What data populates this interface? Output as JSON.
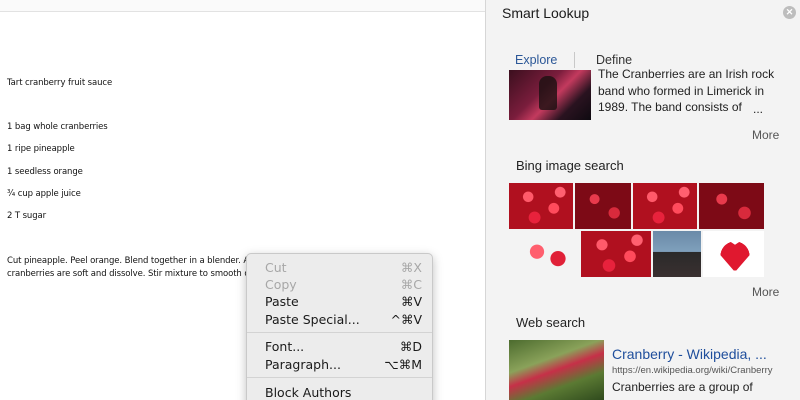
{
  "document": {
    "lines": [
      "Tart cranberry fruit sauce",
      "1 bag whole cranberries",
      "1 ripe pineapple",
      "1 seedless orange",
      "¾ cup apple juice",
      "2 T sugar",
      "Cut pineapple. Peel orange. Blend together in a blender. Add cran",
      "cranberries are soft and dissolve. Stir mixture to smooth out cran"
    ]
  },
  "context_menu": {
    "items": [
      {
        "label": "Cut",
        "shortcut": "⌘X",
        "enabled": false
      },
      {
        "label": "Copy",
        "shortcut": "⌘C",
        "enabled": false
      },
      {
        "label": "Paste",
        "shortcut": "⌘V",
        "enabled": true
      },
      {
        "label": "Paste Special...",
        "shortcut": "^⌘V",
        "enabled": true
      },
      {
        "label": "Font...",
        "shortcut": "⌘D",
        "enabled": true
      },
      {
        "label": "Paragraph...",
        "shortcut": "⌥⌘M",
        "enabled": true
      },
      {
        "label": "Block Authors",
        "shortcut": "",
        "enabled": true
      }
    ]
  },
  "smart_lookup": {
    "title": "Smart Lookup",
    "close_icon": "close-icon",
    "tabs": [
      {
        "label": "Explore",
        "active": true
      },
      {
        "label": "Define",
        "active": false
      }
    ],
    "explore": {
      "snippet_lines": [
        "The Cranberries are an Irish rock",
        "band who formed in Limerick in",
        "1989. The band consists of",
        "..."
      ],
      "more": "More"
    },
    "bing": {
      "heading": "Bing image search",
      "more": "More"
    },
    "web": {
      "heading": "Web search",
      "link": "Cranberry - Wikipedia, ...",
      "url": "https://en.wikipedia.org/wiki/Cranberry",
      "snippet": "Cranberries are a group of"
    }
  },
  "colors": {
    "link": "#1f4e9c",
    "tab_active": "#2b5797",
    "pane_bg": "#f3f3f3"
  }
}
